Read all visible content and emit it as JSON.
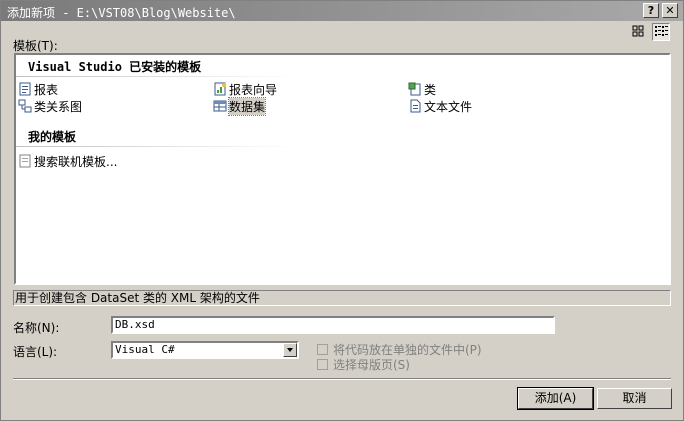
{
  "window": {
    "title": "添加新项 - E:\\VST08\\Blog\\Website\\"
  },
  "titlebar": {
    "help_label": "?",
    "close_label": "✕"
  },
  "templates_label": "模板(T):",
  "list": {
    "group1": {
      "heading": "Visual Studio 已安装的模板",
      "items": [
        {
          "label": "报表",
          "icon": "report-icon"
        },
        {
          "label": "报表向导",
          "icon": "report-wizard-icon"
        },
        {
          "label": "类",
          "icon": "class-icon"
        },
        {
          "label": "类关系图",
          "icon": "class-diagram-icon"
        },
        {
          "label": "数据集",
          "icon": "dataset-icon",
          "selected": true
        },
        {
          "label": "文本文件",
          "icon": "text-file-icon"
        }
      ]
    },
    "group2": {
      "heading": "我的模板",
      "items": [
        {
          "label": "搜索联机模板...",
          "icon": "search-online-icon"
        }
      ]
    }
  },
  "description": "用于创建包含 DataSet 类的 XML 架构的文件",
  "name_label": "名称(N):",
  "name_value": "DB.xsd",
  "language_label": "语言(L):",
  "language_value": "Visual C#",
  "options": {
    "separate_code": "将代码放在单独的文件中(P)",
    "master_page": "选择母版页(S)"
  },
  "buttons": {
    "add": "添加(A)",
    "cancel": "取消"
  },
  "colors": {
    "titlebar": "#7a7a7a",
    "face": "#d4d0c8",
    "list_bg": "#ffffff"
  }
}
